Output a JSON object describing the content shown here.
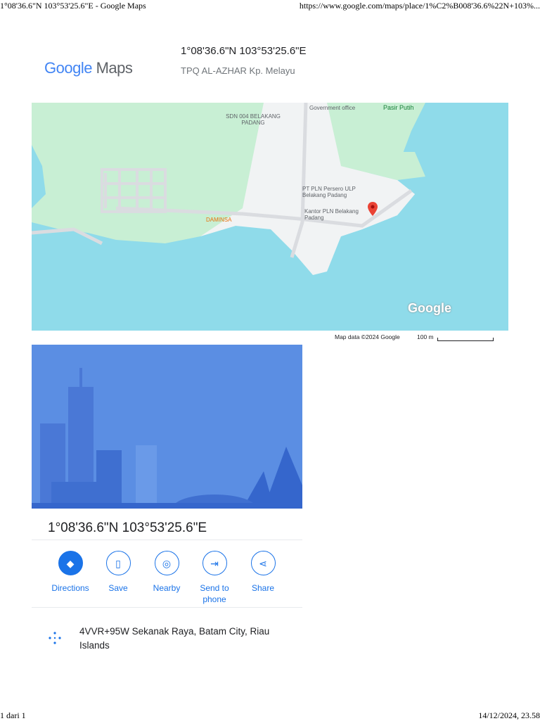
{
  "print_header": {
    "title": "1°08'36.6\"N 103°53'25.6\"E - Google Maps",
    "url": "https://www.google.com/maps/place/1%C2%B008'36.6%22N+103%..."
  },
  "logo": {
    "google": "Google",
    "maps": "Maps"
  },
  "place": {
    "title": "1°08'36.6\"N 103°53'25.6\"E",
    "subtitle": "TPQ AL-AZHAR Kp. Melayu"
  },
  "map": {
    "labels": {
      "gov": "Government office",
      "school": "SDN 004 BELAKANG PADANG",
      "pasir": "Pasir Putih",
      "pln1": "PT PLN Persero ULP Belakang Padang",
      "pln2": "Kantor PLN Belakang Padang",
      "daminsa": "DAMINSA",
      "google": "Google"
    },
    "attribution": "Map data ©2024 Google",
    "scale": "100 m",
    "colors": {
      "water": "#8fdbea",
      "park": "#c8efd4",
      "land": "#f1f3f4",
      "pin": "#ea4335"
    }
  },
  "panel": {
    "title": "1°08'36.6\"N 103°53'25.6\"E",
    "actions": [
      {
        "label": "Directions"
      },
      {
        "label": "Save"
      },
      {
        "label": "Nearby"
      },
      {
        "label": "Send to phone"
      },
      {
        "label": "Share"
      }
    ],
    "address": "4VVR+95W Sekanak Raya, Batam City, Riau Islands"
  },
  "print_footer": {
    "page": "1 dari 1",
    "datetime": "14/12/2024, 23.58"
  }
}
